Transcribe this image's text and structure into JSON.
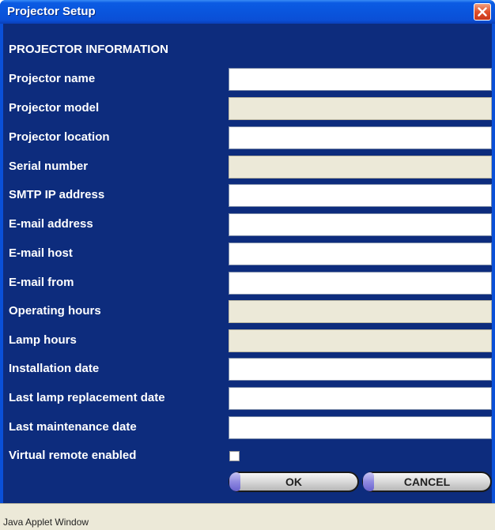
{
  "window": {
    "title": "Projector Setup"
  },
  "section_heading": "PROJECTOR INFORMATION",
  "fields": [
    {
      "label": "Projector name",
      "value": "",
      "readonly": false
    },
    {
      "label": "Projector model",
      "value": "",
      "readonly": true
    },
    {
      "label": "Projector location",
      "value": "",
      "readonly": false
    },
    {
      "label": "Serial number",
      "value": "",
      "readonly": true
    },
    {
      "label": "SMTP IP address",
      "value": "",
      "readonly": false
    },
    {
      "label": "E-mail address",
      "value": "",
      "readonly": false
    },
    {
      "label": "E-mail host",
      "value": "",
      "readonly": false
    },
    {
      "label": "E-mail from",
      "value": "",
      "readonly": false
    },
    {
      "label": "Operating hours",
      "value": "",
      "readonly": true
    },
    {
      "label": "Lamp hours",
      "value": "",
      "readonly": true
    },
    {
      "label": "Installation date",
      "value": "",
      "readonly": false
    },
    {
      "label": "Last lamp replacement date",
      "value": "",
      "readonly": false
    },
    {
      "label": "Last maintenance date",
      "value": "",
      "readonly": false
    }
  ],
  "virtual_remote": {
    "label": "Virtual remote enabled",
    "checked": false
  },
  "buttons": {
    "ok_label": "OK",
    "cancel_label": "CANCEL"
  },
  "status_bar": {
    "text": "Java Applet Window"
  },
  "icons": {
    "close": "close-icon"
  },
  "colors": {
    "panel": "#0d2c7d",
    "titlebar": "#0a55dd",
    "readonly_field": "#ece9d8"
  }
}
